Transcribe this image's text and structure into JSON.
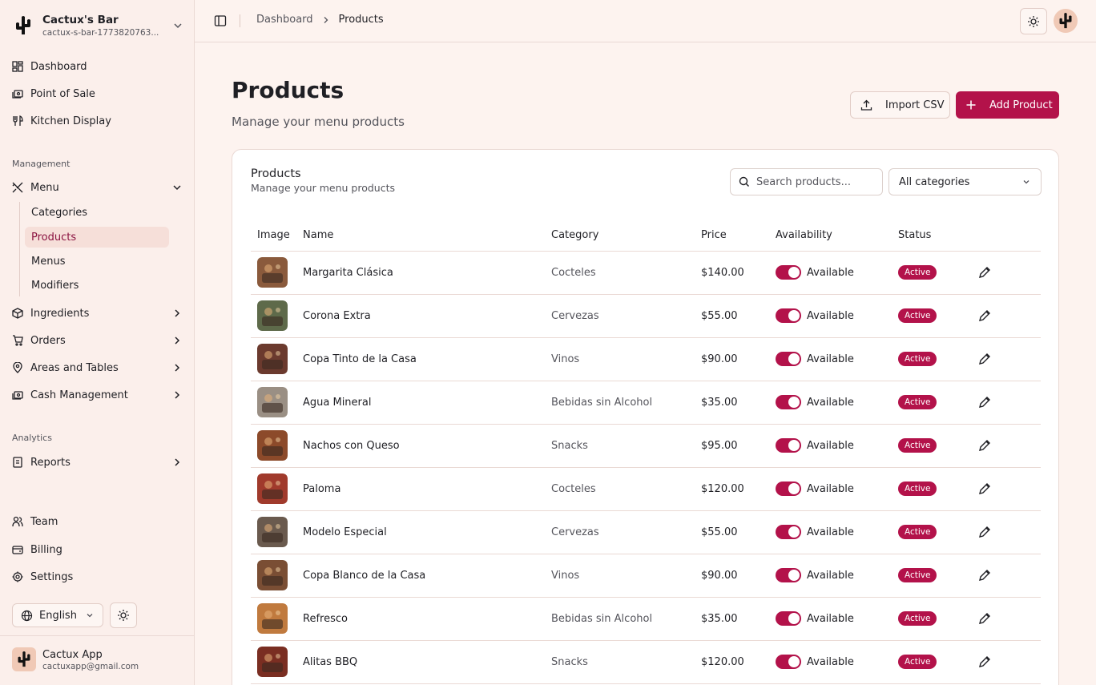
{
  "brand": {
    "name": "Cactux's Bar",
    "slug": "cactux-s-bar-1773820763..."
  },
  "nav": {
    "dashboard": "Dashboard",
    "pos": "Point of Sale",
    "kitchen": "Kitchen Display",
    "management_label": "Management",
    "menu": "Menu",
    "menu_sub": [
      "Categories",
      "Products",
      "Menus",
      "Modifiers"
    ],
    "ingredients": "Ingredients",
    "orders": "Orders",
    "areas": "Areas and Tables",
    "cash": "Cash Management",
    "analytics_label": "Analytics",
    "reports": "Reports",
    "team": "Team",
    "billing": "Billing",
    "settings": "Settings"
  },
  "language": "English",
  "user": {
    "name": "Cactux App",
    "email": "cactuxapp@gmail.com"
  },
  "breadcrumb": [
    "Dashboard",
    "Products"
  ],
  "page": {
    "title": "Products",
    "subtitle": "Manage your menu products"
  },
  "actions": {
    "import": "Import CSV",
    "add": "Add Product"
  },
  "card": {
    "title": "Products",
    "subtitle": "Manage your menu products",
    "search_placeholder": "Search products...",
    "category_filter": "All categories"
  },
  "table": {
    "headers": [
      "Image",
      "Name",
      "Category",
      "Price",
      "Availability",
      "Status"
    ],
    "rows": [
      {
        "name": "Margarita Clásica",
        "category": "Cocteles",
        "price": "$140.00",
        "availability": "Available",
        "status": "Active",
        "thumb": "#8a5a3c"
      },
      {
        "name": "Corona Extra",
        "category": "Cervezas",
        "price": "$55.00",
        "availability": "Available",
        "status": "Active",
        "thumb": "#5e6a4a"
      },
      {
        "name": "Copa Tinto de la Casa",
        "category": "Vinos",
        "price": "$90.00",
        "availability": "Available",
        "status": "Active",
        "thumb": "#6b3a2e"
      },
      {
        "name": "Agua Mineral",
        "category": "Bebidas sin Alcohol",
        "price": "$35.00",
        "availability": "Available",
        "status": "Active",
        "thumb": "#9a8f84"
      },
      {
        "name": "Nachos con Queso",
        "category": "Snacks",
        "price": "$95.00",
        "availability": "Available",
        "status": "Active",
        "thumb": "#8c4a2a"
      },
      {
        "name": "Paloma",
        "category": "Cocteles",
        "price": "$120.00",
        "availability": "Available",
        "status": "Active",
        "thumb": "#a03a2c"
      },
      {
        "name": "Modelo Especial",
        "category": "Cervezas",
        "price": "$55.00",
        "availability": "Available",
        "status": "Active",
        "thumb": "#6a5a4e"
      },
      {
        "name": "Copa Blanco de la Casa",
        "category": "Vinos",
        "price": "$90.00",
        "availability": "Available",
        "status": "Active",
        "thumb": "#7a4e34"
      },
      {
        "name": "Refresco",
        "category": "Bebidas sin Alcohol",
        "price": "$35.00",
        "availability": "Available",
        "status": "Active",
        "thumb": "#c07a3e"
      },
      {
        "name": "Alitas BBQ",
        "category": "Snacks",
        "price": "$120.00",
        "availability": "Available",
        "status": "Active",
        "thumb": "#7a2e22"
      }
    ]
  },
  "colors": {
    "accent": "#b3124a",
    "background": "#fdf3ef",
    "sidebar": "#fbefeb"
  }
}
